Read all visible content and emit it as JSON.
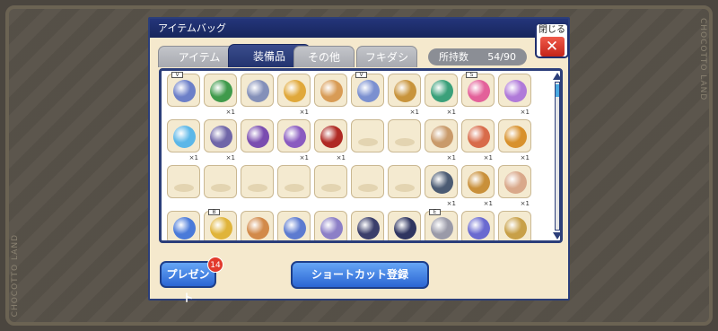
{
  "window_title": "アイテムバッグ",
  "close_label": "閉じる",
  "close_symbol": "✕",
  "tabs": [
    {
      "label": "アイテム",
      "active": false
    },
    {
      "label": "装備品",
      "active": true
    },
    {
      "label": "その他",
      "active": false
    },
    {
      "label": "フキダシ",
      "active": false
    }
  ],
  "capacity": {
    "label": "所持数",
    "value": "54/90"
  },
  "slots": [
    {
      "tag": "V",
      "qty": "",
      "color": "#6c7fc8",
      "icon": "armor-icon"
    },
    {
      "tag": "",
      "qty": "×1",
      "color": "#3f9a4b",
      "icon": "necklace-icon"
    },
    {
      "tag": "",
      "qty": "",
      "color": "#8490b9",
      "icon": "armor-icon"
    },
    {
      "tag": "",
      "qty": "×1",
      "color": "#e0a83a",
      "icon": "necklace-icon"
    },
    {
      "tag": "",
      "qty": "",
      "color": "#d89b55",
      "icon": "crown-icon"
    },
    {
      "tag": "V",
      "qty": "",
      "color": "#7b90d0",
      "icon": "wings-icon"
    },
    {
      "tag": "",
      "qty": "×1",
      "color": "#c8943c",
      "icon": "wings-icon"
    },
    {
      "tag": "",
      "qty": "×1",
      "color": "#3aa07a",
      "icon": "necklace-icon"
    },
    {
      "tag": "S",
      "qty": "",
      "color": "#e3619a",
      "icon": "gem-icon"
    },
    {
      "tag": "",
      "qty": "×1",
      "color": "#b07ad9",
      "icon": "gem-icon"
    },
    {
      "tag": "",
      "qty": "×1",
      "color": "#5bb7e8",
      "icon": "wings-icon"
    },
    {
      "tag": "",
      "qty": "×1",
      "color": "#7066a8",
      "icon": "armor-icon"
    },
    {
      "tag": "",
      "qty": "",
      "color": "#7a4db0",
      "icon": "sword-icon"
    },
    {
      "tag": "",
      "qty": "×1",
      "color": "#8a5bc0",
      "icon": "sword-icon"
    },
    {
      "tag": "",
      "qty": "×1",
      "color": "#b02a24",
      "icon": "crown-icon"
    },
    {
      "tag": "",
      "qty": "",
      "color": "",
      "icon": ""
    },
    {
      "tag": "",
      "qty": "",
      "color": "",
      "icon": ""
    },
    {
      "tag": "",
      "qty": "×1",
      "color": "#c99a6a",
      "icon": "necklace-icon"
    },
    {
      "tag": "",
      "qty": "×1",
      "color": "#d86b4a",
      "icon": "scroll-icon"
    },
    {
      "tag": "",
      "qty": "×1",
      "color": "#d8912c",
      "icon": "armor-icon"
    },
    {
      "tag": "",
      "qty": "",
      "color": "",
      "icon": ""
    },
    {
      "tag": "",
      "qty": "",
      "color": "",
      "icon": ""
    },
    {
      "tag": "",
      "qty": "",
      "color": "",
      "icon": ""
    },
    {
      "tag": "",
      "qty": "",
      "color": "",
      "icon": ""
    },
    {
      "tag": "",
      "qty": "",
      "color": "",
      "icon": ""
    },
    {
      "tag": "",
      "qty": "",
      "color": "",
      "icon": ""
    },
    {
      "tag": "",
      "qty": "",
      "color": "",
      "icon": ""
    },
    {
      "tag": "",
      "qty": "×1",
      "color": "#4b5b73",
      "icon": "boots-icon"
    },
    {
      "tag": "",
      "qty": "×1",
      "color": "#c9903a",
      "icon": "boots-icon"
    },
    {
      "tag": "",
      "qty": "×1",
      "color": "#d9a88a",
      "icon": "necklace-icon"
    },
    {
      "tag": "",
      "qty": "",
      "color": "#4a7ad9",
      "icon": "sword-icon"
    },
    {
      "tag": "B",
      "qty": "",
      "color": "#e0b43a",
      "icon": "ring-icon"
    },
    {
      "tag": "",
      "qty": "",
      "color": "#d28a4a",
      "icon": "crown-icon"
    },
    {
      "tag": "",
      "qty": "",
      "color": "#5d7bd0",
      "icon": "sword-icon"
    },
    {
      "tag": "",
      "qty": "",
      "color": "#8c7fc7",
      "icon": "armor-icon"
    },
    {
      "tag": "",
      "qty": "",
      "color": "#3b3f6b",
      "icon": "armor-icon"
    },
    {
      "tag": "",
      "qty": "",
      "color": "#2f3560",
      "icon": "armor-icon"
    },
    {
      "tag": "E",
      "qty": "",
      "color": "#9a9aa8",
      "icon": "armor-icon"
    },
    {
      "tag": "",
      "qty": "",
      "color": "#6a6ad0",
      "icon": "sword-icon"
    },
    {
      "tag": "",
      "qty": "",
      "color": "#c8a048",
      "icon": "armor-icon"
    }
  ],
  "buttons": {
    "present": "プレゼント",
    "shortcut": "ショートカット登録"
  },
  "present_badge": "14",
  "frame_text": {
    "left": "CHOCOTTO LAND",
    "right": "CHOCOTTO LAND"
  }
}
